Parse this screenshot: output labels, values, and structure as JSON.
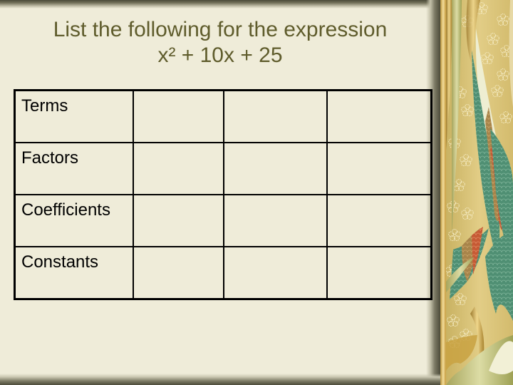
{
  "slide": {
    "title_line1": "List the following for the expression",
    "title_line2": "x² + 10x + 25"
  },
  "table": {
    "rows": [
      {
        "label": "Terms",
        "cells": [
          "",
          "",
          ""
        ]
      },
      {
        "label": "Factors",
        "cells": [
          "",
          "",
          ""
        ]
      },
      {
        "label": "Coefficients",
        "cells": [
          "",
          "",
          ""
        ]
      },
      {
        "label": "Constants",
        "cells": [
          "",
          "",
          ""
        ]
      }
    ]
  },
  "theme": {
    "background": "#efecd9",
    "title_color": "#5f5c2c",
    "table_border": "#000000",
    "decoration_gold": "#d9c37a",
    "decoration_teal": "#4f8f73",
    "decoration_red": "#c65a35"
  },
  "decoration": {
    "icon": "floral-kimono-pattern"
  }
}
